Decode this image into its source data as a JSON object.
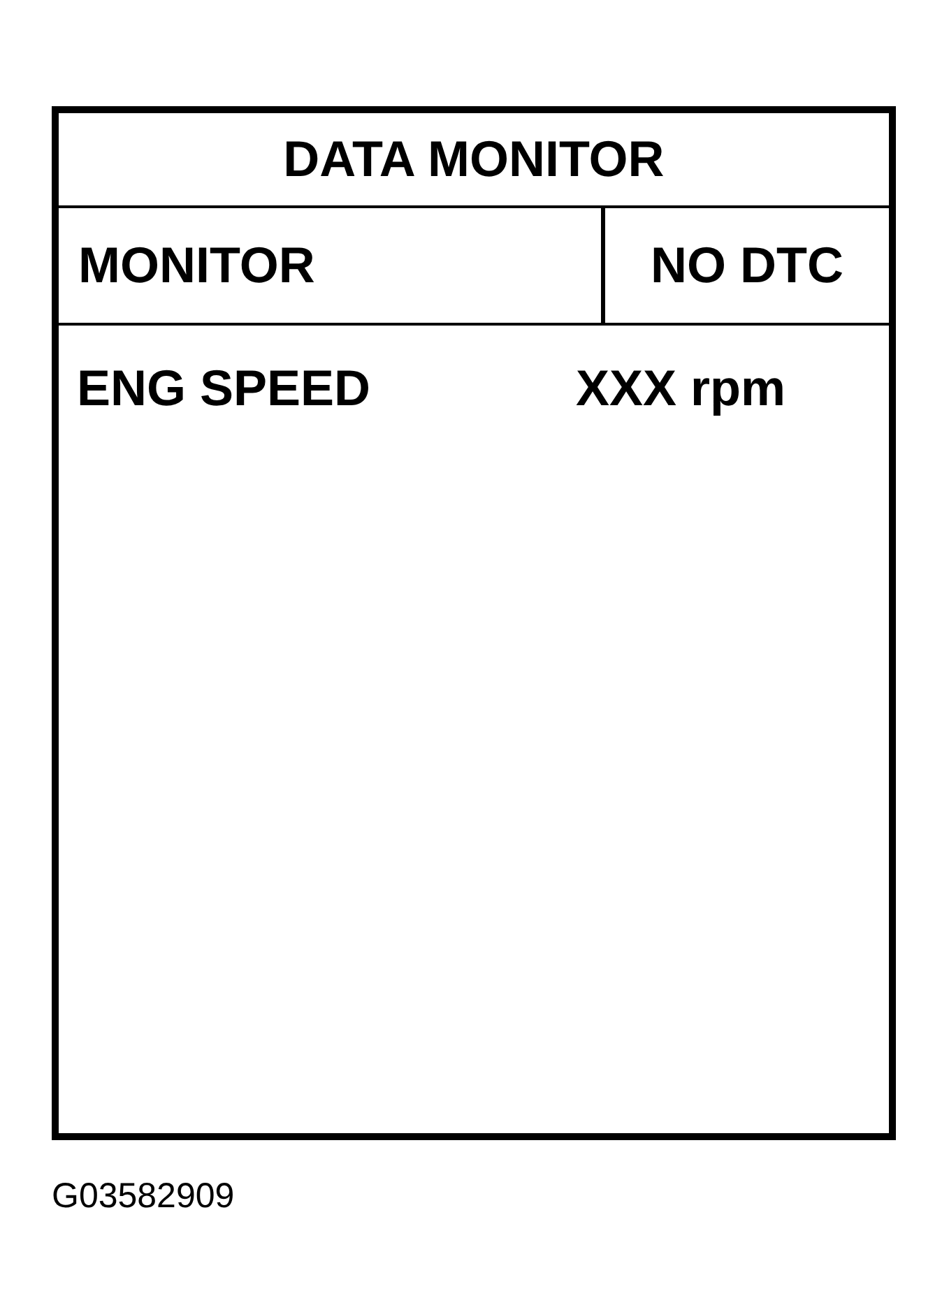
{
  "panel": {
    "title": "DATA MONITOR",
    "mode": "MONITOR",
    "status": "NO DTC",
    "parameters": [
      {
        "name": "ENG SPEED",
        "value": "XXX rpm"
      }
    ]
  },
  "figure_code": "G03582909"
}
